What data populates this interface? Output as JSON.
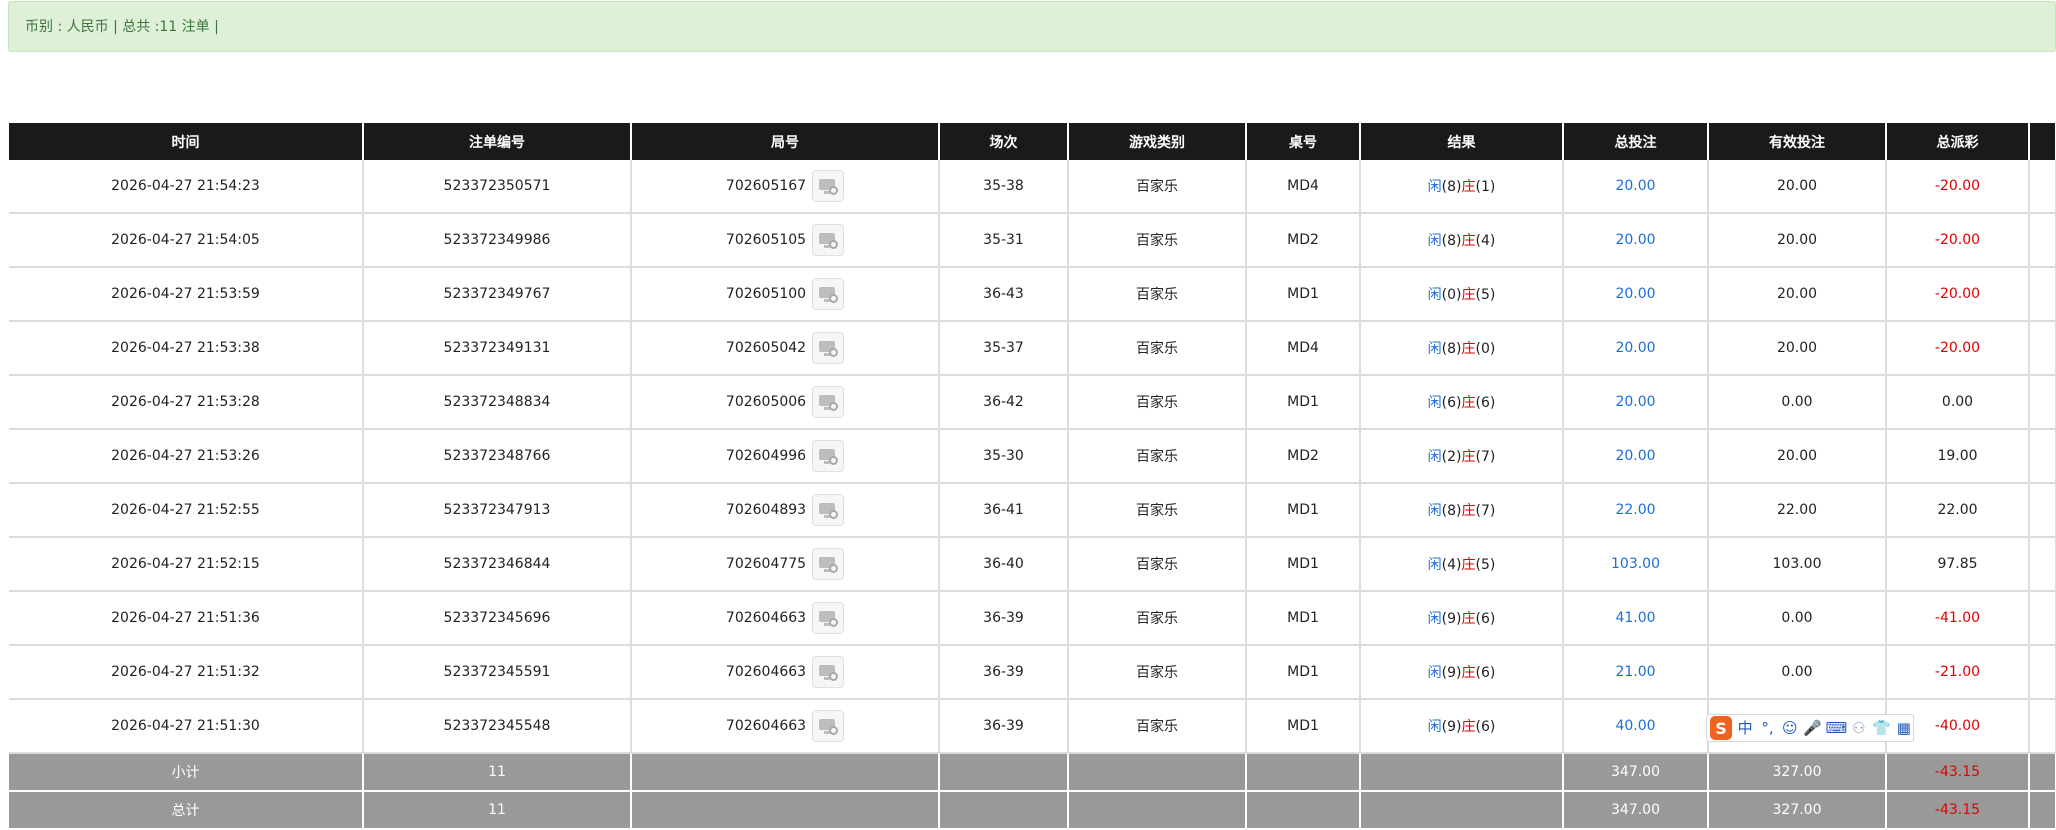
{
  "summary": {
    "text": "币别 : 人民币 | 总共 :11 注单 |"
  },
  "table": {
    "headers": [
      "时间",
      "注单编号",
      "局号",
      "场次",
      "游戏类别",
      "桌号",
      "结果",
      "总投注",
      "有效投注",
      "总派彩"
    ],
    "rows": [
      {
        "time": "2026-04-27 21:54:23",
        "bet_no": "523372350571",
        "round": "702605167",
        "shoe": "35-38",
        "game": "百家乐",
        "table_no": "MD4",
        "player": "闲",
        "player_pts": "(8)",
        "banker": "庄",
        "banker_pts": "(1)",
        "total_bet": "20.00",
        "valid_bet": "20.00",
        "payout": "-20.00",
        "payout_neg": true
      },
      {
        "time": "2026-04-27 21:54:05",
        "bet_no": "523372349986",
        "round": "702605105",
        "shoe": "35-31",
        "game": "百家乐",
        "table_no": "MD2",
        "player": "闲",
        "player_pts": "(8)",
        "banker": "庄",
        "banker_pts": "(4)",
        "total_bet": "20.00",
        "valid_bet": "20.00",
        "payout": "-20.00",
        "payout_neg": true
      },
      {
        "time": "2026-04-27 21:53:59",
        "bet_no": "523372349767",
        "round": "702605100",
        "shoe": "36-43",
        "game": "百家乐",
        "table_no": "MD1",
        "player": "闲",
        "player_pts": "(0)",
        "banker": "庄",
        "banker_pts": "(5)",
        "total_bet": "20.00",
        "valid_bet": "20.00",
        "payout": "-20.00",
        "payout_neg": true
      },
      {
        "time": "2026-04-27 21:53:38",
        "bet_no": "523372349131",
        "round": "702605042",
        "shoe": "35-37",
        "game": "百家乐",
        "table_no": "MD4",
        "player": "闲",
        "player_pts": "(8)",
        "banker": "庄",
        "banker_pts": "(0)",
        "total_bet": "20.00",
        "valid_bet": "20.00",
        "payout": "-20.00",
        "payout_neg": true
      },
      {
        "time": "2026-04-27 21:53:28",
        "bet_no": "523372348834",
        "round": "702605006",
        "shoe": "36-42",
        "game": "百家乐",
        "table_no": "MD1",
        "player": "闲",
        "player_pts": "(6)",
        "banker": "庄",
        "banker_pts": "(6)",
        "total_bet": "20.00",
        "valid_bet": "0.00",
        "payout": "0.00",
        "payout_neg": false
      },
      {
        "time": "2026-04-27 21:53:26",
        "bet_no": "523372348766",
        "round": "702604996",
        "shoe": "35-30",
        "game": "百家乐",
        "table_no": "MD2",
        "player": "闲",
        "player_pts": "(2)",
        "banker": "庄",
        "banker_pts": "(7)",
        "total_bet": "20.00",
        "valid_bet": "20.00",
        "payout": "19.00",
        "payout_neg": false
      },
      {
        "time": "2026-04-27 21:52:55",
        "bet_no": "523372347913",
        "round": "702604893",
        "shoe": "36-41",
        "game": "百家乐",
        "table_no": "MD1",
        "player": "闲",
        "player_pts": "(8)",
        "banker": "庄",
        "banker_pts": "(7)",
        "total_bet": "22.00",
        "valid_bet": "22.00",
        "payout": "22.00",
        "payout_neg": false
      },
      {
        "time": "2026-04-27 21:52:15",
        "bet_no": "523372346844",
        "round": "702604775",
        "shoe": "36-40",
        "game": "百家乐",
        "table_no": "MD1",
        "player": "闲",
        "player_pts": "(4)",
        "banker": "庄",
        "banker_pts": "(5)",
        "total_bet": "103.00",
        "valid_bet": "103.00",
        "payout": "97.85",
        "payout_neg": false
      },
      {
        "time": "2026-04-27 21:51:36",
        "bet_no": "523372345696",
        "round": "702604663",
        "shoe": "36-39",
        "game": "百家乐",
        "table_no": "MD1",
        "player": "闲",
        "player_pts": "(9)",
        "banker": "庄",
        "banker_pts": "(6)",
        "total_bet": "41.00",
        "valid_bet": "0.00",
        "payout": "-41.00",
        "payout_neg": true
      },
      {
        "time": "2026-04-27 21:51:32",
        "bet_no": "523372345591",
        "round": "702604663",
        "shoe": "36-39",
        "game": "百家乐",
        "table_no": "MD1",
        "player": "闲",
        "player_pts": "(9)",
        "banker": "庄",
        "banker_pts": "(6)",
        "total_bet": "21.00",
        "valid_bet": "0.00",
        "payout": "-21.00",
        "payout_neg": true
      },
      {
        "time": "2026-04-27 21:51:30",
        "bet_no": "523372345548",
        "round": "702604663",
        "shoe": "36-39",
        "game": "百家乐",
        "table_no": "MD1",
        "player": "闲",
        "player_pts": "(9)",
        "banker": "庄",
        "banker_pts": "(6)",
        "total_bet": "40.00",
        "valid_bet": "",
        "payout": "-40.00",
        "payout_neg": true
      }
    ],
    "subtotal": {
      "label": "小计",
      "count": "11",
      "total_bet": "347.00",
      "valid_bet": "327.00",
      "payout": "-43.15"
    },
    "grandtotal": {
      "label": "总计",
      "count": "11",
      "total_bet": "347.00",
      "valid_bet": "327.00",
      "payout": "-43.15"
    }
  },
  "ime_toolbar": {
    "logo": "S",
    "items": [
      {
        "glyph": "中",
        "icon": "chinese-mode-icon"
      },
      {
        "glyph": "°,",
        "icon": "punctuation-icon"
      },
      {
        "glyph": "☺",
        "icon": "emoji-icon"
      },
      {
        "glyph": "🎤",
        "icon": "microphone-icon"
      },
      {
        "glyph": "⌨",
        "icon": "keyboard-icon"
      },
      {
        "glyph": "⚇",
        "icon": "user-icon"
      },
      {
        "glyph": "👕",
        "icon": "skin-icon"
      },
      {
        "glyph": "▦",
        "icon": "toolbox-icon"
      }
    ],
    "colors": {
      "logo": "#f0621d",
      "icon": "#1e5bb8"
    }
  },
  "colors": {
    "info_bg": "#dff0d8",
    "info_text": "#3c763d",
    "header_bg": "#1a1a1a",
    "blue_text": "#1a6fd8",
    "red_text": "#e00000",
    "summary_bg": "#999999"
  }
}
